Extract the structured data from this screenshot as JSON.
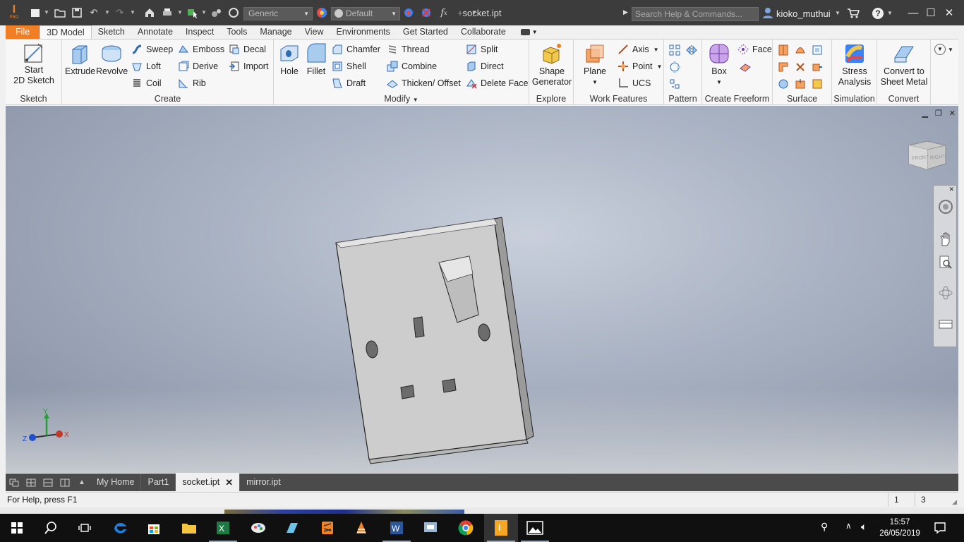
{
  "titlebar": {
    "app_logo_letter": "I",
    "app_logo_sub": "PRO",
    "document_title": "socket.ipt",
    "material_combo": "Generic",
    "appearance_combo": "Default",
    "search_placeholder": "Search Help & Commands...",
    "user_name": "kioko_muthui"
  },
  "tabs": [
    "File",
    "3D Model",
    "Sketch",
    "Annotate",
    "Inspect",
    "Tools",
    "Manage",
    "View",
    "Environments",
    "Get Started",
    "Collaborate"
  ],
  "ribbon": {
    "sketch": {
      "label": "Sketch",
      "start_line1": "Start",
      "start_line2": "2D Sketch"
    },
    "create": {
      "label": "Create",
      "extrude": "Extrude",
      "revolve": "Revolve",
      "sweep": "Sweep",
      "loft": "Loft",
      "coil": "Coil",
      "emboss": "Emboss",
      "derive": "Derive",
      "rib": "Rib",
      "decal": "Decal",
      "import": "Import"
    },
    "modify": {
      "label": "Modify",
      "hole": "Hole",
      "fillet": "Fillet",
      "chamfer": "Chamfer",
      "shell": "Shell",
      "draft": "Draft",
      "thread": "Thread",
      "combine": "Combine",
      "thicken": "Thicken/ Offset",
      "split": "Split",
      "direct": "Direct",
      "delete_face": "Delete Face"
    },
    "explore": {
      "label": "Explore",
      "shape_line1": "Shape",
      "shape_line2": "Generator"
    },
    "work_features": {
      "label": "Work Features",
      "plane": "Plane",
      "axis": "Axis",
      "point": "Point",
      "ucs": "UCS"
    },
    "pattern": {
      "label": "Pattern"
    },
    "freeform": {
      "label": "Create Freeform",
      "box": "Box",
      "face": "Face"
    },
    "surface": {
      "label": "Surface"
    },
    "simulation": {
      "label": "Simulation",
      "line1": "Stress",
      "line2": "Analysis"
    },
    "convert": {
      "label": "Convert",
      "line1": "Convert to",
      "line2": "Sheet Metal"
    }
  },
  "viewcube": {
    "front": "FRONT",
    "right": "RIGHT"
  },
  "triad": {
    "x": "X",
    "y": "Y",
    "z": "Z"
  },
  "doc_tabs": [
    "My Home",
    "Part1",
    "socket.ipt",
    "mirror.ipt"
  ],
  "active_doc_tab": "socket.ipt",
  "status": {
    "help_text": "For Help, press F1",
    "count1": "1",
    "count2": "3"
  },
  "taskbar": {
    "time": "15:57",
    "date": "26/05/2019"
  },
  "colors": {
    "file_tab": "#f07e25",
    "titlebar": "#3c3c3c",
    "viewport_top": "#c9d0dc",
    "viewport_edge": "#8b95a8",
    "socket_face": "#cdcdcd"
  }
}
